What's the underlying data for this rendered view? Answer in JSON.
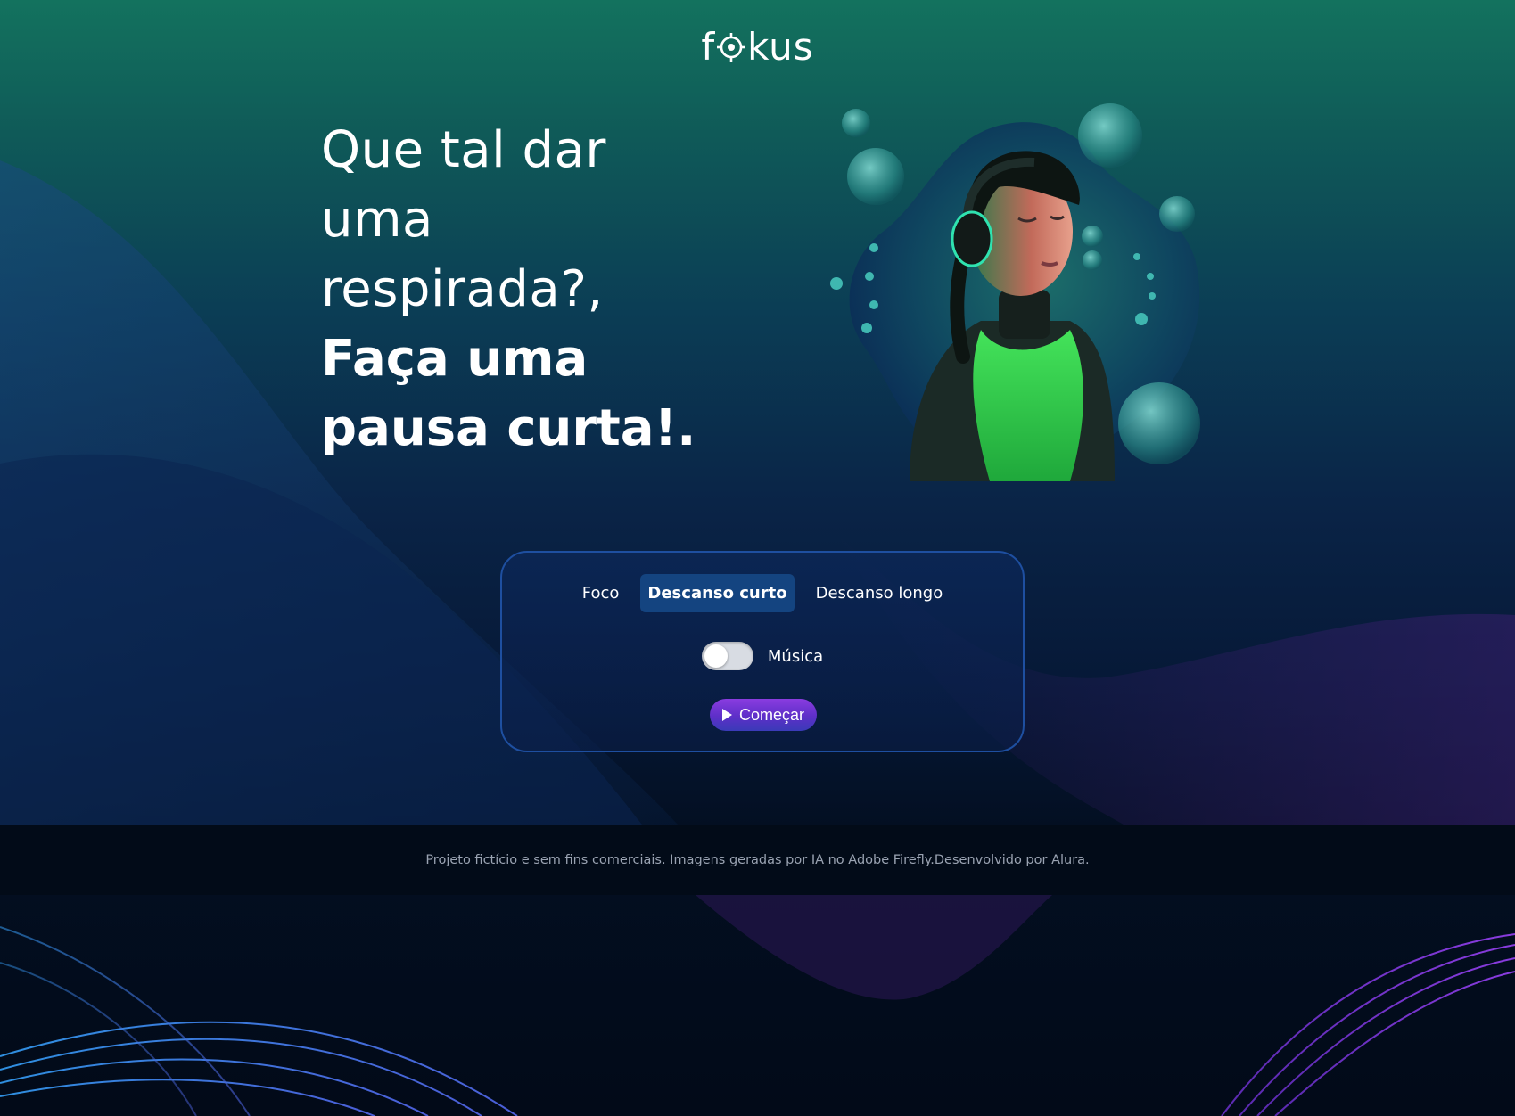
{
  "header": {
    "logo_text": "fokus",
    "logo_icon": "target-icon"
  },
  "hero": {
    "headline_light": [
      "Que tal dar",
      "uma",
      "respirada?,"
    ],
    "headline_bold": [
      "Faça uma",
      "pausa curta!."
    ],
    "image_icon": "woman-headphones-illustration"
  },
  "timer": {
    "tabs": [
      {
        "label": "Foco",
        "active": false
      },
      {
        "label": "Descanso curto",
        "active": true
      },
      {
        "label": "Descanso longo",
        "active": false
      }
    ],
    "music_label": "Música",
    "music_enabled": false,
    "start_label": "Começar",
    "start_icon": "play-icon"
  },
  "footer": {
    "text": "Projeto fictício e sem fins comerciais. Imagens geradas por IA no Adobe Firefly.Desenvolvido por Alura."
  },
  "colors": {
    "top_gradient": "#13725e",
    "bottom_background": "#010a16",
    "active_tab": "#144480",
    "card_border": "#1e4fa0",
    "start_button": "#8a3ce0",
    "footer_text": "#9aa3b2"
  }
}
